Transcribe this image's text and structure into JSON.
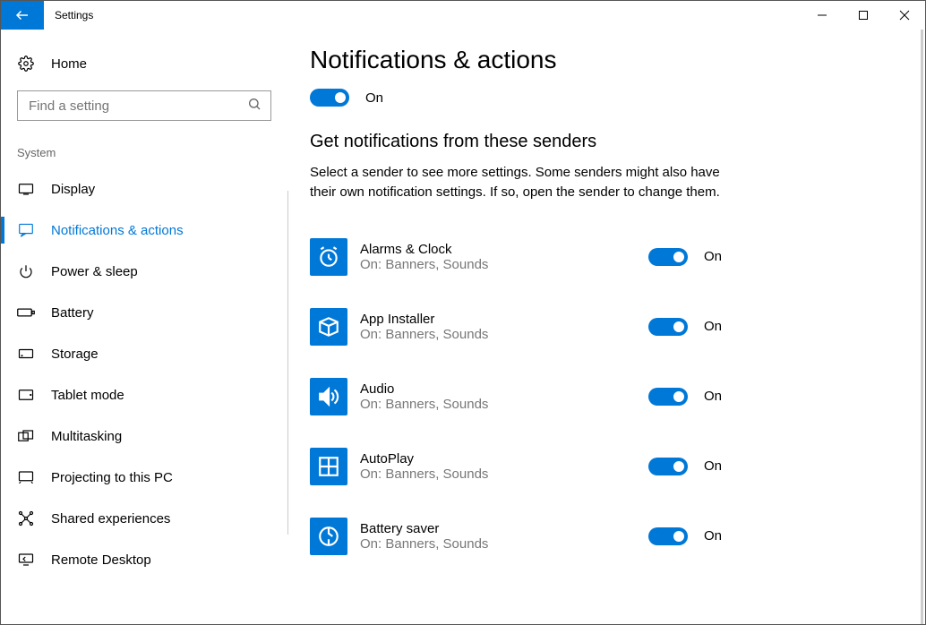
{
  "window": {
    "title": "Settings"
  },
  "sidebar": {
    "home_label": "Home",
    "search_placeholder": "Find a setting",
    "section_label": "System",
    "items": [
      {
        "label": "Display"
      },
      {
        "label": "Notifications & actions"
      },
      {
        "label": "Power & sleep"
      },
      {
        "label": "Battery"
      },
      {
        "label": "Storage"
      },
      {
        "label": "Tablet mode"
      },
      {
        "label": "Multitasking"
      },
      {
        "label": "Projecting to this PC"
      },
      {
        "label": "Shared experiences"
      },
      {
        "label": "Remote Desktop"
      }
    ]
  },
  "content": {
    "page_title": "Notifications & actions",
    "master_toggle_label": "On",
    "section_heading": "Get notifications from these senders",
    "section_desc": "Select a sender to see more settings. Some senders might also have their own notification settings. If so, open the sender to change them.",
    "senders": [
      {
        "name": "Alarms & Clock",
        "sub": "On: Banners, Sounds",
        "state": "On"
      },
      {
        "name": "App Installer",
        "sub": "On: Banners, Sounds",
        "state": "On"
      },
      {
        "name": "Audio",
        "sub": "On: Banners, Sounds",
        "state": "On"
      },
      {
        "name": "AutoPlay",
        "sub": "On: Banners, Sounds",
        "state": "On"
      },
      {
        "name": "Battery saver",
        "sub": "On: Banners, Sounds",
        "state": "On"
      }
    ]
  }
}
